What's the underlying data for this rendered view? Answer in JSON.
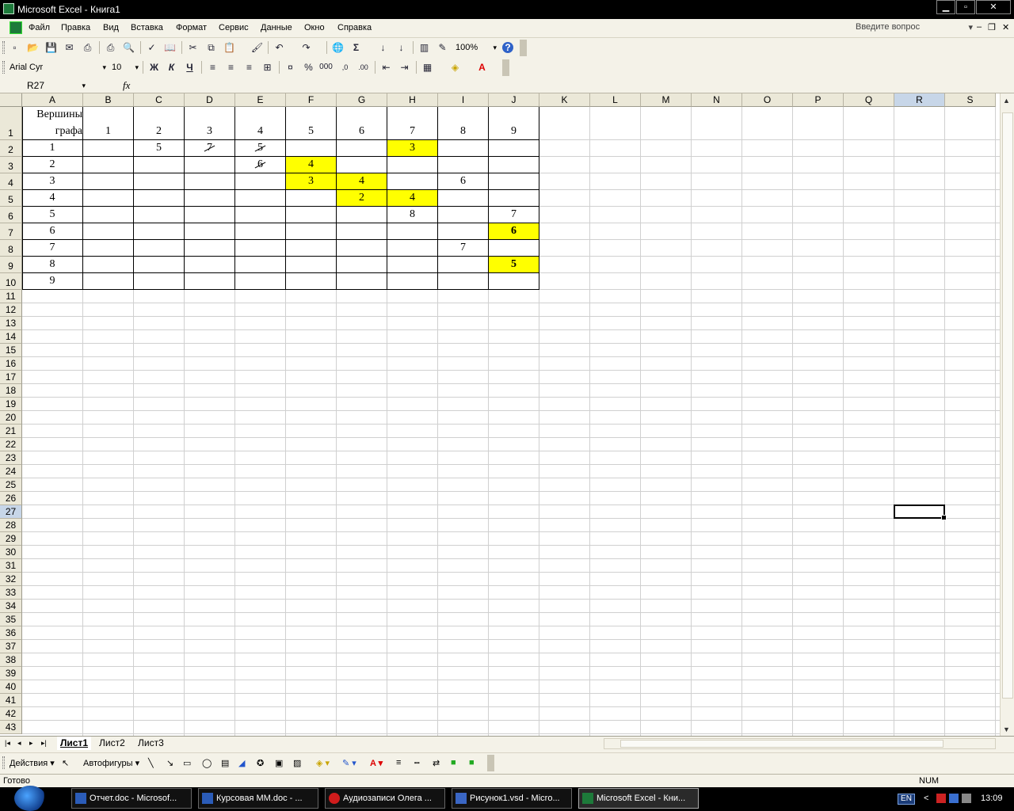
{
  "window": {
    "title": "Microsoft Excel - Книга1",
    "buttons": {
      "minimize": "▁",
      "maximize": "▫",
      "close": "✕"
    }
  },
  "menu": {
    "items": [
      "Файл",
      "Правка",
      "Вид",
      "Вставка",
      "Формат",
      "Сервис",
      "Данные",
      "Окно",
      "Справка"
    ],
    "ask_placeholder": "Введите вопрос",
    "ask_arrow": "▾",
    "mdi": {
      "minimize": "‒",
      "restore": "❐",
      "close": "✕"
    }
  },
  "toolbar_standard": {
    "icons": [
      "new-icon",
      "open-icon",
      "save-icon",
      "permission-icon",
      "email-icon",
      "print-icon",
      "print-preview-icon",
      "spelling-icon",
      "research-icon",
      "cut-icon",
      "copy-icon",
      "paste-icon",
      "format-painter-icon",
      "undo-icon",
      "redo-icon",
      "hyperlink-icon",
      "autosum-icon",
      "sort-ascending-icon",
      "sort-descending-icon",
      "chart-wizard-icon",
      "drawing-icon",
      "help-icon"
    ],
    "glyphs": [
      "▫",
      "📂",
      "💾",
      "✉",
      "⎙",
      "⎙",
      "🔍",
      "✓",
      "📖",
      "✂",
      "⧉",
      "📋",
      "🖌",
      "↶",
      "↷",
      "🌐",
      "Σ",
      "↓",
      "↓",
      "▥",
      "✎",
      "?"
    ],
    "zoom": "100%"
  },
  "toolbar_formatting": {
    "font": "Arial Cyr",
    "size": "10",
    "bold": "Ж",
    "italic": "К",
    "underline": "Ч",
    "percent": "%",
    "thousands": "000",
    "glyphs": {
      "align_left": "≡",
      "align_center": "≡",
      "align_right": "≡",
      "merge": "⊞",
      "currency": "¤",
      "inc_dec": ",0",
      "dec_dec": ".00",
      "outdent": "⇤",
      "indent": "⇥",
      "borders": "▦",
      "fill": "◈",
      "font_color": "A"
    }
  },
  "formula_bar": {
    "name_box": "R27",
    "name_arrow": "▾",
    "fx": "fx"
  },
  "columns": [
    "A",
    "B",
    "C",
    "D",
    "E",
    "F",
    "G",
    "H",
    "I",
    "J",
    "K",
    "L",
    "M",
    "N",
    "O",
    "P",
    "Q",
    "R",
    "S"
  ],
  "selected_column": "R",
  "selected_row": "27",
  "rows": [
    "1",
    "2",
    "3",
    "4",
    "5",
    "6",
    "7",
    "8",
    "9",
    "10",
    "11",
    "12",
    "13",
    "14",
    "15",
    "16",
    "17",
    "18",
    "19",
    "20",
    "21",
    "22",
    "23",
    "24",
    "25",
    "26",
    "27",
    "28",
    "29",
    "30",
    "31",
    "32",
    "33",
    "34",
    "35",
    "36",
    "37",
    "38",
    "39",
    "40",
    "41",
    "42",
    "43"
  ],
  "table": {
    "corner_header_line1": "Вершины",
    "corner_header_line2": "графа",
    "col_headers": [
      "1",
      "2",
      "3",
      "4",
      "5",
      "6",
      "7",
      "8",
      "9"
    ],
    "row_labels": [
      "1",
      "2",
      "3",
      "4",
      "5",
      "6",
      "7",
      "8",
      "9"
    ],
    "cells": [
      {
        "row": 2,
        "col": "C",
        "value": "5",
        "style": "normal"
      },
      {
        "row": 2,
        "col": "D",
        "value": "7",
        "style": "struck"
      },
      {
        "row": 2,
        "col": "E",
        "value": "5",
        "style": "struck"
      },
      {
        "row": 2,
        "col": "H",
        "value": "3",
        "style": "yellow"
      },
      {
        "row": 3,
        "col": "E",
        "value": "6",
        "style": "struck"
      },
      {
        "row": 3,
        "col": "F",
        "value": "4",
        "style": "yellow"
      },
      {
        "row": 4,
        "col": "F",
        "value": "3",
        "style": "yellow"
      },
      {
        "row": 4,
        "col": "G",
        "value": "4",
        "style": "yellow"
      },
      {
        "row": 4,
        "col": "I",
        "value": "6",
        "style": "normal"
      },
      {
        "row": 5,
        "col": "G",
        "value": "2",
        "style": "yellow"
      },
      {
        "row": 5,
        "col": "H",
        "value": "4",
        "style": "yellow"
      },
      {
        "row": 6,
        "col": "H",
        "value": "8",
        "style": "normal"
      },
      {
        "row": 6,
        "col": "J",
        "value": "7",
        "style": "normal"
      },
      {
        "row": 7,
        "col": "J",
        "value": "6",
        "style": "yellow-bold"
      },
      {
        "row": 8,
        "col": "I",
        "value": "7",
        "style": "normal"
      },
      {
        "row": 9,
        "col": "J",
        "value": "5",
        "style": "yellow-bold"
      }
    ]
  },
  "sheet_tabs": [
    "Лист1",
    "Лист2",
    "Лист3"
  ],
  "tab_nav": [
    "|◂",
    "◂",
    "▸",
    "▸|"
  ],
  "drawing_bar": {
    "actions": "Действия ▾",
    "autoshapes": "Автофигуры ▾"
  },
  "status": {
    "left": "Готово",
    "num": "NUM"
  },
  "taskbar": {
    "items": [
      {
        "label": "Отчет.doc - Microsof...",
        "icon": "word-icon"
      },
      {
        "label": "Курсовая ММ.doc - ...",
        "icon": "word-icon"
      },
      {
        "label": "Аудиозаписи Олега ...",
        "icon": "opera-icon"
      },
      {
        "label": "Рисунок1.vsd - Micro...",
        "icon": "visio-icon"
      },
      {
        "label": "Microsoft Excel - Кни...",
        "icon": "excel-icon"
      }
    ],
    "lang": "EN",
    "tray_arrow": "<",
    "time": "13:09"
  },
  "colors": {
    "highlight": "#ffff00",
    "selection_header": "#c7d6e8",
    "chrome": "#f4f2e8"
  }
}
